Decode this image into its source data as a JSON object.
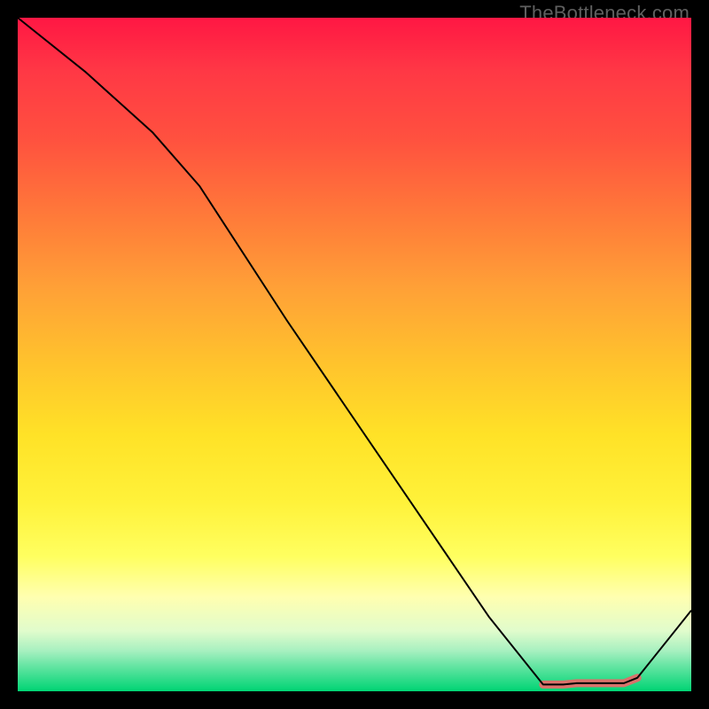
{
  "watermark": "TheBottleneck.com",
  "chart_data": {
    "type": "line",
    "title": "",
    "xlabel": "",
    "ylabel": "",
    "xlim": [
      0,
      100
    ],
    "ylim": [
      0,
      100
    ],
    "grid": false,
    "legend": false,
    "background_gradient": {
      "top": "#ff1744",
      "middle": "#ffe227",
      "bottom": "#00d474"
    },
    "series": [
      {
        "name": "curve",
        "color": "#000000",
        "stroke_width": 2,
        "x": [
          0,
          10,
          20,
          27,
          40,
          55,
          70,
          78,
          81,
          83,
          86,
          88,
          90,
          92,
          100
        ],
        "y": [
          100,
          92,
          83,
          75,
          55,
          33,
          11,
          1,
          1,
          1.2,
          1.2,
          1.2,
          1.2,
          2,
          12
        ]
      },
      {
        "name": "highlight",
        "color": "#d9726b",
        "stroke_width": 9,
        "linecap": "round",
        "x": [
          78,
          81,
          83,
          86,
          88,
          90,
          92
        ],
        "y": [
          1,
          1,
          1.2,
          1.2,
          1.2,
          1.2,
          2
        ]
      }
    ]
  }
}
